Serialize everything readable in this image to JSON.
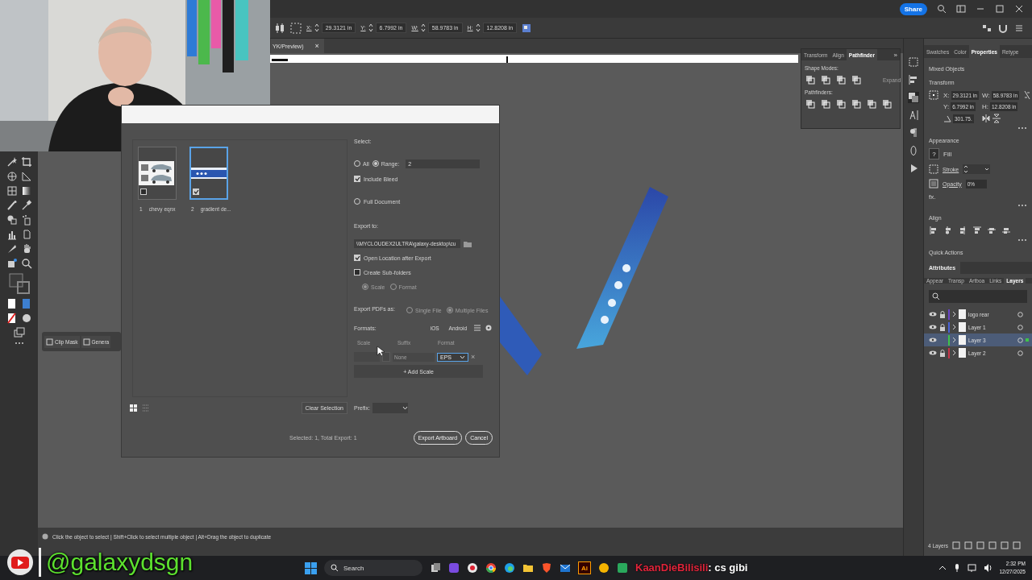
{
  "menu_bar": {
    "share_button": "Share"
  },
  "control_bar": {
    "fields": [
      {
        "label": "X:",
        "value": "29.3121 in"
      },
      {
        "label": "Y:",
        "value": "6.7992 in"
      },
      {
        "label": "W:",
        "value": "58.9783 in"
      },
      {
        "label": "H:",
        "value": "12.8208 in"
      }
    ]
  },
  "document_tab": {
    "title": "YK/Preview)",
    "close": "×"
  },
  "context_bar": {
    "buttons": [
      "Clip Mask",
      "Genera"
    ]
  },
  "pathfinder_panel": {
    "tabs": [
      {
        "label": "Transform",
        "selected": false
      },
      {
        "label": "Align",
        "selected": false
      },
      {
        "label": "Pathfinder",
        "selected": true
      }
    ],
    "overflow": "»",
    "shape_modes": "Shape Modes:",
    "expand_button": {
      "label": "Expand",
      "disabled": true
    },
    "pathfinders": "Pathfinders:"
  },
  "properties_panel": {
    "tabs": [
      {
        "label": "Swatches",
        "selected": false
      },
      {
        "label": "Color",
        "selected": false
      },
      {
        "label": "Properties",
        "selected": true
      },
      {
        "label": "Retype",
        "selected": false
      }
    ],
    "selection": "Mixed Objects",
    "transform": {
      "title": "Transform",
      "fields": [
        {
          "label": "X:",
          "value": "29.3121 in"
        },
        {
          "label": "W:",
          "value": "58.9783 in"
        },
        {
          "label": "Y:",
          "value": "6.7992 in"
        },
        {
          "label": "H:",
          "value": "12.8208 in"
        }
      ],
      "angle": "301.75."
    },
    "appearance": {
      "title": "Appearance",
      "fill_swatch": "?",
      "fill": "Fill",
      "stroke": "Stroke",
      "opacity_label": "Opacity",
      "opacity": "0%",
      "effects": "fx."
    },
    "align": {
      "title": "Align"
    },
    "quick_actions": "Quick Actions"
  },
  "layers_panel": {
    "header_tab": "Attributes",
    "tabs": [
      {
        "label": "Appear",
        "selected": false
      },
      {
        "label": "Transp",
        "selected": false
      },
      {
        "label": "Artboa",
        "selected": false
      },
      {
        "label": "Links",
        "selected": false
      },
      {
        "label": "Layers",
        "selected": true
      }
    ],
    "layers": [
      {
        "name": "logo rear",
        "color": "#6a45c8",
        "locked": true,
        "selected": false
      },
      {
        "name": "Layer 1",
        "color": "#4a62d6",
        "locked": true,
        "selected": false
      },
      {
        "name": "Layer 3",
        "color": "#3fc24a",
        "locked": false,
        "selected": true
      },
      {
        "name": "Layer 2",
        "color": "#c8354a",
        "locked": true,
        "selected": false
      }
    ],
    "count": "4 Layers"
  },
  "export_dialog": {
    "artboards": [
      {
        "number": "1",
        "name": "chevy eqnx",
        "kind": "vehicles",
        "checked": false,
        "selected": false
      },
      {
        "number": "2",
        "name": "gradient de...",
        "kind": "banner",
        "checked": true,
        "selected": true
      }
    ],
    "select_label": "Select:",
    "scope": [
      {
        "label": "All",
        "selected": false
      },
      {
        "label": "Range:",
        "selected": true
      }
    ],
    "range": "2",
    "include_bleed": {
      "label": "Include Bleed",
      "checked": true
    },
    "full_document": {
      "label": "Full Document",
      "selected": false
    },
    "export_to_label": "Export to:",
    "path": "\\\\MYCLOUDEX2ULTRA\\galaxy-desktop\\cu",
    "open_location": {
      "label": "Open Location after Export",
      "checked": true
    },
    "sub_folders": {
      "label": "Create Sub-folders",
      "checked": false
    },
    "sub_folder_options": {
      "disabled": true,
      "options": [
        {
          "label": "Scale",
          "selected": true
        },
        {
          "label": "Format",
          "selected": false
        }
      ]
    },
    "pdf_label": "Export PDFs as:",
    "pdf_options": {
      "disabled": true,
      "options": [
        {
          "label": "Single File",
          "selected": false
        },
        {
          "label": "Multiple Files",
          "selected": true
        }
      ]
    },
    "formats": {
      "label": "Formats:",
      "presets": [
        "iOS",
        "Android"
      ],
      "columns": [
        "Scale",
        "Suffix",
        "Format"
      ],
      "rows": [
        {
          "suffix_placeholder": "None",
          "format": "EPS",
          "remove": "×"
        }
      ],
      "add_button": "+ Add Scale"
    },
    "clear_button": "Clear Selection",
    "prefix_label": "Prefix:",
    "summary": "Selected: 1, Total Export: 1",
    "export_button": "Export Artboard",
    "cancel_button": "Cancel"
  },
  "status_bar": {
    "hint": "Click the object to select  |  Shift+Click to select multiple object  |  Alt+Drag the object to duplicate"
  },
  "taskbar": {
    "search": "Search",
    "app_label": "Ai",
    "time": "2:32 PM",
    "date": "12/27/2025"
  },
  "chat_overlay": {
    "user": "KaanDieBilisili",
    "message": ": cs gibi"
  },
  "stream_overlay": {
    "handle": "@galaxydsgn"
  }
}
